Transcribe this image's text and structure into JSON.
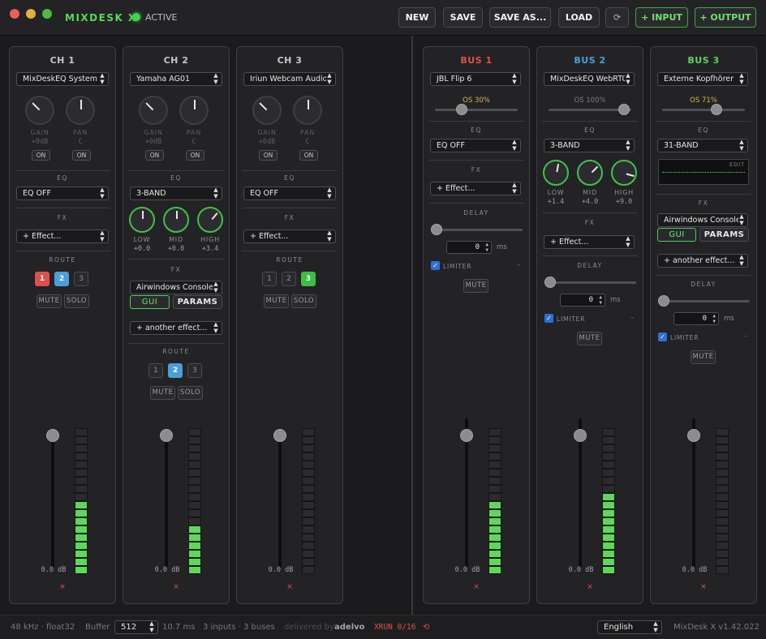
{
  "app": {
    "title": "MIXDESK X",
    "status": "ACTIVE"
  },
  "colors": {
    "accent_green": "#58d85c",
    "bus1": "#e0504a",
    "bus2": "#4a9fd8",
    "bus3": "#58d85c",
    "orange": "#d4b84a"
  },
  "toolbar": {
    "new": "NEW",
    "save": "SAVE",
    "save_as": "SAVE AS...",
    "load": "LOAD",
    "refresh_icon": "⟳",
    "add_input": "+ INPUT",
    "add_output": "+ OUTPUT"
  },
  "labels": {
    "eq": "EQ",
    "fx": "FX",
    "route": "ROUTE",
    "delay": "DELAY",
    "gain": "GAIN",
    "pan": "PAN",
    "on": "ON",
    "mute": "MUTE",
    "solo": "SOLO",
    "limiter": "LIMITER",
    "ms": "ms",
    "gui": "GUI",
    "params": "PARAMS",
    "low": "LOW",
    "mid": "MID",
    "high": "HIGH",
    "edit": "EDIT",
    "db": "0.0 dB",
    "remove": "×",
    "dash": "–",
    "route1": "1",
    "route2": "2",
    "route3": "3"
  },
  "channels": [
    {
      "name": "CH 1",
      "device": "MixDeskEQ System",
      "gain": "+0dB",
      "pan": "C",
      "eq": "EQ OFF",
      "fx": "+ Effect...",
      "routes_active": [
        1,
        2
      ],
      "meter_level": 0.5
    },
    {
      "name": "CH 2",
      "device": "Yamaha AG01",
      "gain": "+0dB",
      "pan": "C",
      "eq": "3-BAND",
      "eq_low": "+0.0",
      "eq_mid": "+0.0",
      "eq_high": "+3.4",
      "fx_plugin": "Airwindows Console",
      "fx_more": "+ another effect...",
      "routes_active": [
        2
      ],
      "meter_level": 0.35
    },
    {
      "name": "CH 3",
      "device": "Iriun Webcam Audio",
      "gain": "+0dB",
      "pan": "C",
      "eq": "EQ OFF",
      "fx": "+ Effect...",
      "routes_active": [
        3
      ],
      "meter_level": 0
    }
  ],
  "buses": [
    {
      "name": "BUS 1",
      "device": "JBL Flip 6",
      "os": "OS 30%",
      "os_value": 0.3,
      "eq": "EQ OFF",
      "fx": "+ Effect...",
      "delay": "0",
      "meter_level": 0.5
    },
    {
      "name": "BUS 2",
      "device": "MixDeskEQ WebRTC",
      "os": "OS 100%",
      "os_value": 1.0,
      "eq": "3-BAND",
      "eq_low": "+1.4",
      "eq_mid": "+4.0",
      "eq_high": "+9.0",
      "fx": "+ Effect...",
      "delay": "0",
      "meter_level": 0.55
    },
    {
      "name": "BUS 3",
      "device": "Externe Kopfhörer",
      "os": "OS 71%",
      "os_value": 0.71,
      "eq": "31-BAND",
      "fx_plugin": "Airwindows Console",
      "fx_more": "+ another effect...",
      "delay": "0",
      "meter_level": 0
    }
  ],
  "footer": {
    "format": "48 kHz · float32",
    "buffer_label": "Buffer",
    "buffer_value": "512",
    "latency": "10.7 ms",
    "counts": "3 inputs · 3 buses",
    "delivered": "delivered by",
    "brand": "adelvo",
    "xrun": "XRUN 0/16",
    "reset_icon": "⟲",
    "language": "English",
    "version": "MixDesk X v1.42.022"
  }
}
